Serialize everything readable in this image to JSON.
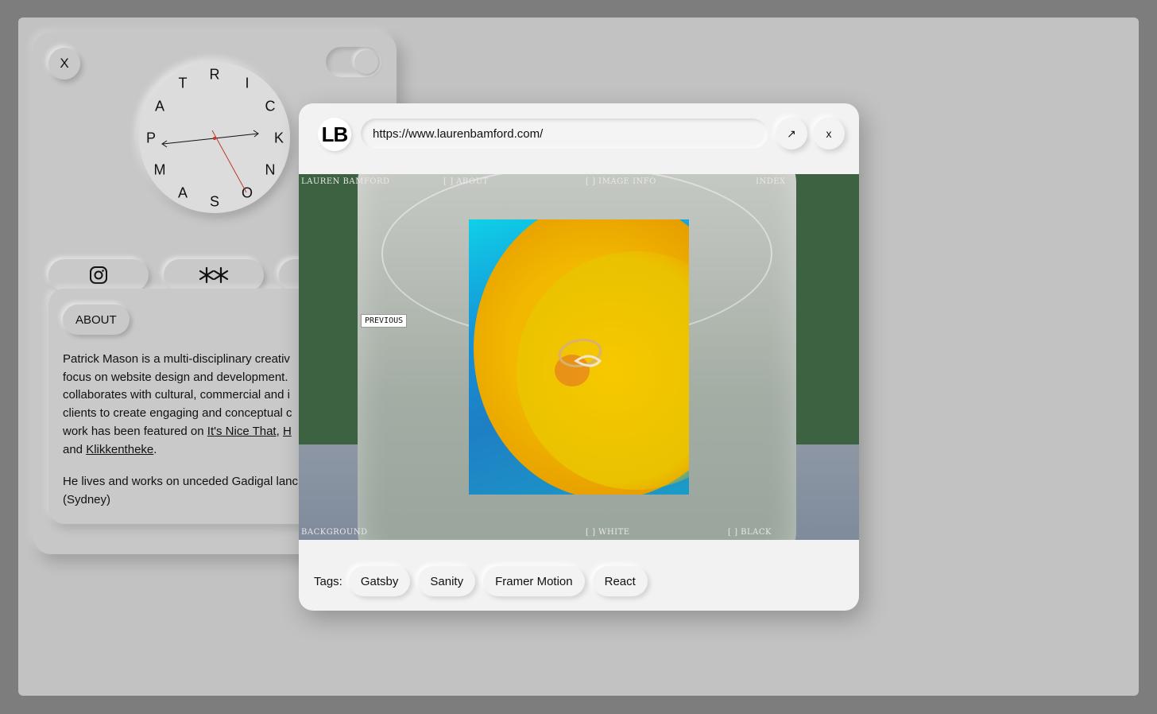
{
  "card": {
    "close_label": "X",
    "clock_letters": [
      "R",
      "I",
      "C",
      "K",
      "N",
      "O",
      "S",
      "A",
      "M",
      "P",
      "A",
      "T"
    ],
    "about_label": "ABOUT",
    "about": {
      "p1_lines": [
        "Patrick Mason is a multi-disciplinary creativ",
        "focus on website design and development.",
        "collaborates with cultural, commercial and i",
        "clients to create engaging and conceptual c"
      ],
      "p1_line5_prefix": "work has been featured on ",
      "link1": "It's Nice That",
      "link_sep": ", ",
      "link2": "H",
      "p1_line6_prefix": "and ",
      "link3": "Klikkentheke",
      "p1_line6_suffix": ".",
      "p2_lines": [
        "He lives and works on unceded Gadigal lanc",
        "(Sydney)"
      ]
    }
  },
  "modal": {
    "logo": "LB",
    "url": "https://www.laurenbamford.com/",
    "open_icon": "↗",
    "close_label": "x",
    "site": {
      "brand": "LAUREN BAMFORD",
      "nav_about": "[ ]  ABOUT",
      "nav_image_info": "[ ]  IMAGE INFO",
      "nav_index": "INDEX",
      "background_label": "BACKGROUND",
      "white": "[ ]  WHITE",
      "black": "[ ]  BLACK",
      "previous": "PREVIOUS"
    },
    "tags_label": "Tags:",
    "tags": [
      "Gatsby",
      "Sanity",
      "Framer Motion",
      "React"
    ]
  },
  "colors": {
    "stage": "#c2c2c2",
    "backdrop": "#7d7d7d",
    "modal_bg": "#f2f2f2",
    "clock_hand_red": "#c0392b"
  }
}
